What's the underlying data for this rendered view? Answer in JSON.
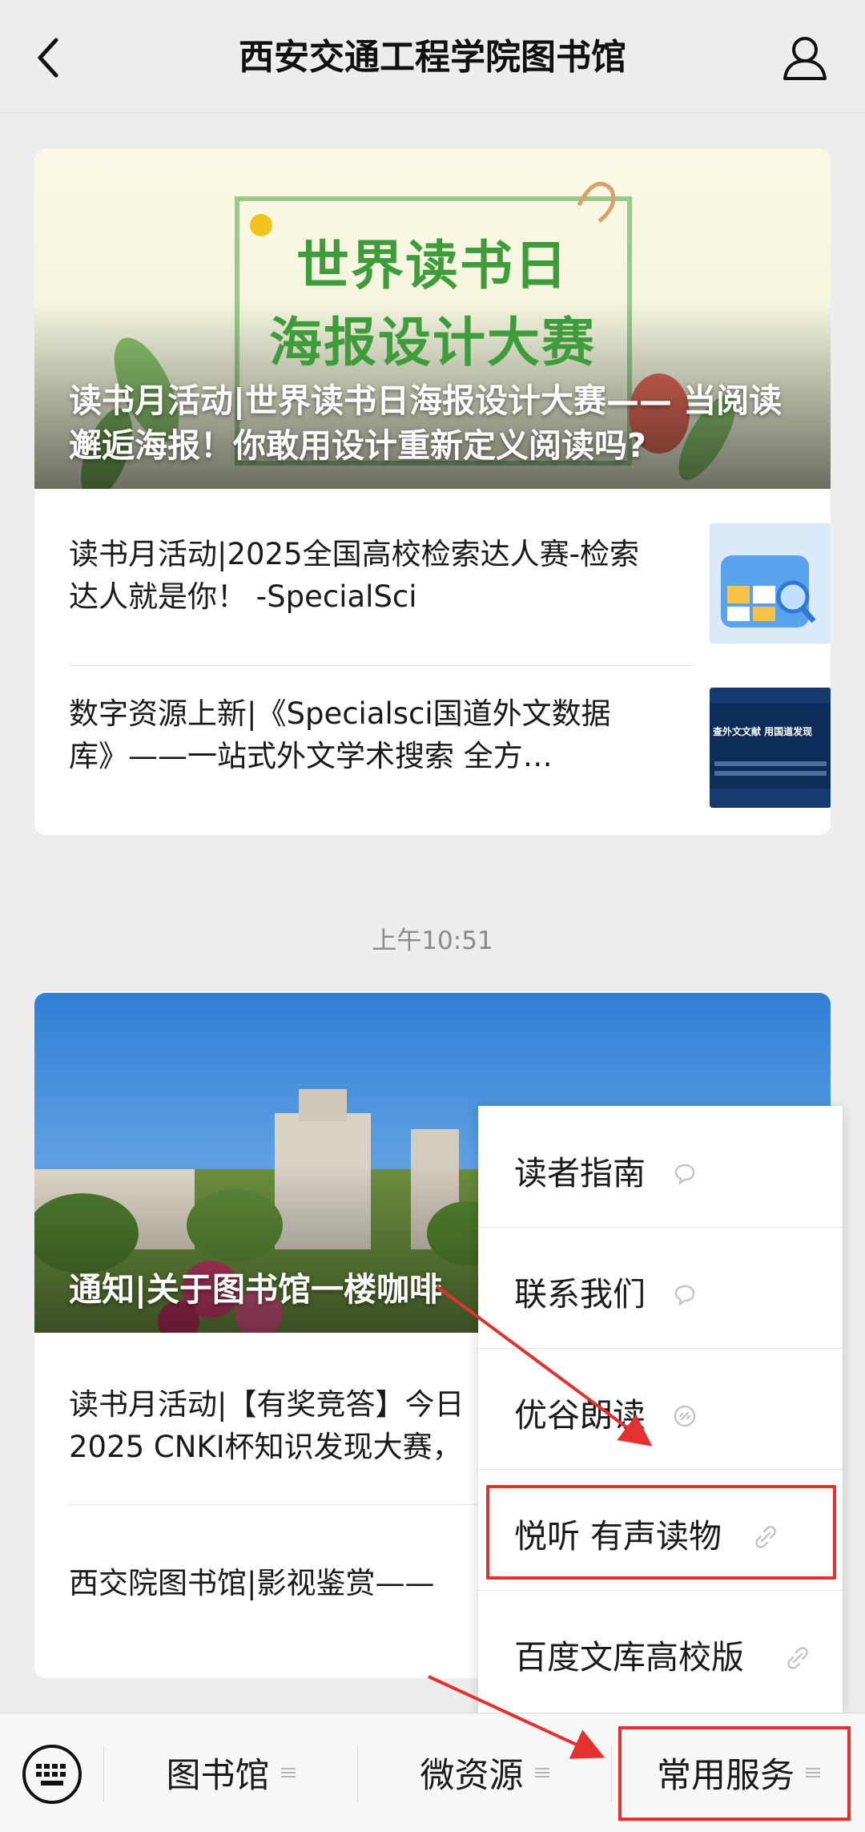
{
  "header": {
    "title": "西安交通工程学院图书馆",
    "back_icon": "chevron-left-icon",
    "profile_icon": "person-icon"
  },
  "article_group_1": {
    "poster_line1": "世界读书日",
    "poster_line2": "海报设计大赛",
    "cover_title": "读书月活动|世界读书日海报设计大赛—— 当阅读邂逅海报！你敢用设计重新定义阅读吗?",
    "items": [
      {
        "title": "读书月活动|2025全国高校检索达人赛-检索达人就是你！ -SpecialSci"
      },
      {
        "title": "数字资源上新|《Specialsci国道外文数据库》——一站式外文学术搜索 全方…"
      }
    ],
    "thumb2_caption": "查外文文献 用国道发现"
  },
  "timestamp": "上午10:51",
  "article_group_2": {
    "cover_title": "通知|关于图书馆一楼咖啡",
    "items": [
      {
        "title": "读书月活动|【有奖竞答】今日\n2025 CNKI杯知识发现大赛，"
      },
      {
        "title": "西交院图书馆|影视鉴赏——"
      }
    ]
  },
  "popup_menu": {
    "items": [
      {
        "label": "读者指南",
        "icon": "chat-bubble-icon"
      },
      {
        "label": "联系我们",
        "icon": "chat-bubble-icon"
      },
      {
        "label": "优谷朗读",
        "icon": "link-icon"
      },
      {
        "label": "悦听 有声读物",
        "icon": "link-icon"
      },
      {
        "label": "百度文库高校版",
        "icon": "link-icon"
      }
    ]
  },
  "bottom_bar": {
    "keyboard_icon": "keyboard-icon",
    "tabs": [
      {
        "label": "图书馆"
      },
      {
        "label": "微资源"
      },
      {
        "label": "常用服务"
      }
    ]
  },
  "colors": {
    "highlight": "#e53030",
    "poster_green": "#3f9c3a",
    "background": "#ededed"
  }
}
